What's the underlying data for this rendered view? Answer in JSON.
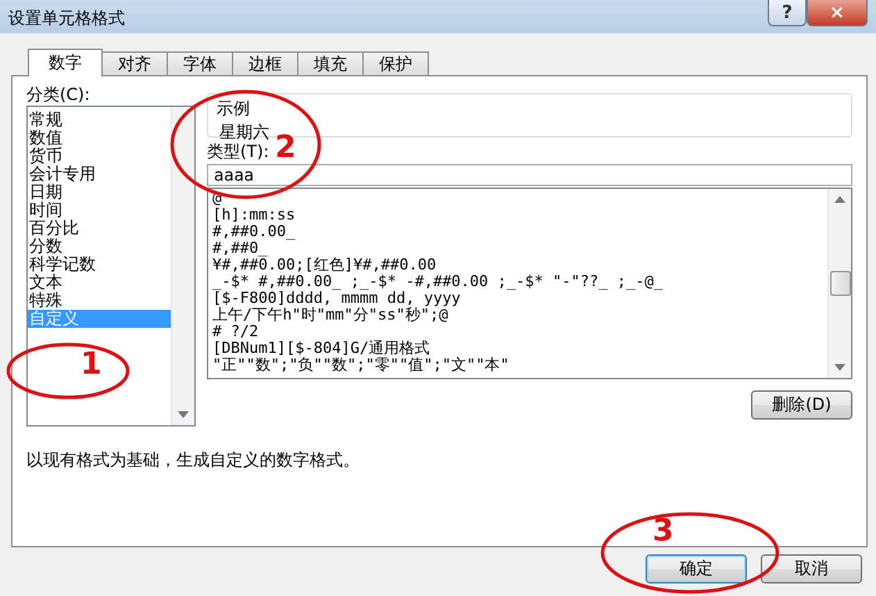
{
  "window": {
    "title": "设置单元格格式",
    "help": "?",
    "close": "×"
  },
  "tabs": [
    {
      "label": "数字",
      "selected": true
    },
    {
      "label": "对齐",
      "selected": false
    },
    {
      "label": "字体",
      "selected": false
    },
    {
      "label": "边框",
      "selected": false
    },
    {
      "label": "填充",
      "selected": false
    },
    {
      "label": "保护",
      "selected": false
    }
  ],
  "category": {
    "label": "分类(C):",
    "items": [
      {
        "label": "常规",
        "selected": false
      },
      {
        "label": "数值",
        "selected": false
      },
      {
        "label": "货币",
        "selected": false
      },
      {
        "label": "会计专用",
        "selected": false
      },
      {
        "label": "日期",
        "selected": false
      },
      {
        "label": "时间",
        "selected": false
      },
      {
        "label": "百分比",
        "selected": false
      },
      {
        "label": "分数",
        "selected": false
      },
      {
        "label": "科学记数",
        "selected": false
      },
      {
        "label": "文本",
        "selected": false
      },
      {
        "label": "特殊",
        "selected": false
      },
      {
        "label": "自定义",
        "selected": true
      }
    ]
  },
  "sample": {
    "label": "示例",
    "value": "星期六"
  },
  "type": {
    "label": "类型(T):",
    "value": "aaaa",
    "items": [
      "@",
      "[h]:mm:ss",
      "#,##0.00_",
      "#,##0_",
      "¥#,##0.00;[红色]¥#,##0.00",
      "_-$* #,##0.00_ ;_-$* -#,##0.00 ;_-$* \"-\"??_ ;_-@_",
      "[$-F800]dddd, mmmm dd, yyyy",
      "上午/下午h\"时\"mm\"分\"ss\"秒\";@",
      "# ?/2",
      "[DBNum1][$-804]G/通用格式",
      "\"正\"\"数\";\"负\"\"数\";\"零\"\"值\";\"文\"\"本\""
    ]
  },
  "delete_button": "删除(D)",
  "description": "以现有格式为基础，生成自定义的数字格式。",
  "buttons": [
    {
      "label": "确定",
      "default": true
    },
    {
      "label": "取消",
      "default": false
    }
  ],
  "annotations": [
    {
      "label": "1"
    },
    {
      "label": "2"
    },
    {
      "label": "3"
    }
  ]
}
